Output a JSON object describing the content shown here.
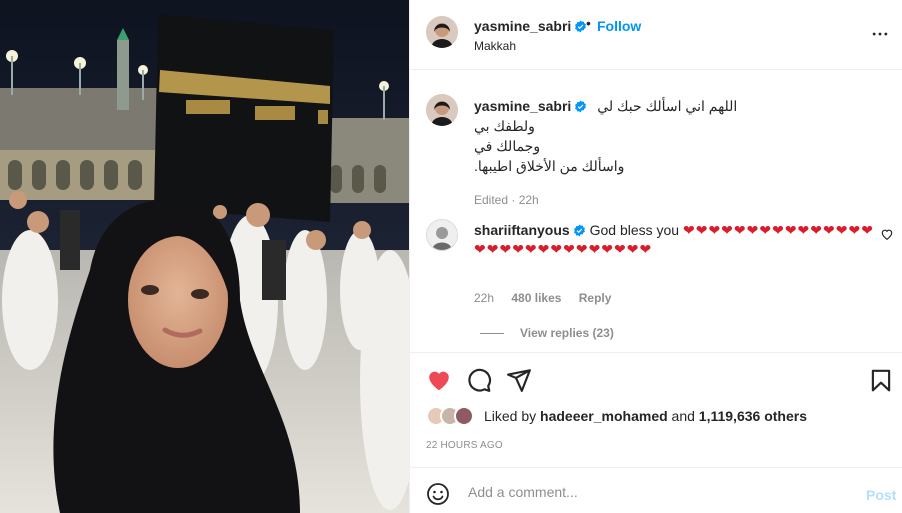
{
  "post": {
    "username": "yasmine_sabri",
    "location": "Makkah",
    "follow_label": "Follow",
    "dot": "•",
    "more_icon": "more-horizontal-icon",
    "caption_lines": [
      "اللهم اني اسألك حبك لي",
      "ولطفك بي",
      "وجمالك في",
      "واسألك من الأخلاق اطيبها."
    ],
    "edited": "Edited · 22h"
  },
  "comment": {
    "username": "shariiftanyous",
    "text": "God bless you",
    "hearts": "❤❤❤❤❤❤❤❤❤❤❤❤❤❤❤❤❤❤❤❤❤❤❤❤❤❤❤❤❤",
    "time": "22h",
    "likes": "480 likes",
    "reply": "Reply",
    "view_replies": "View replies (23)"
  },
  "actions": {
    "like_icon": "heart-filled-icon",
    "comment_icon": "comment-icon",
    "share_icon": "share-icon",
    "save_icon": "bookmark-icon",
    "liked_color": "#ed4956"
  },
  "likes": {
    "prefix": "Liked by",
    "user": "hadeeer_mohamed",
    "and": "and",
    "count": "1,119,636 others"
  },
  "timestamp": "22 HOURS AGO",
  "add_comment": {
    "placeholder": "Add a comment...",
    "post_label": "Post",
    "post_color": "#b2dffc"
  },
  "colors": {
    "verified": "#0095f6",
    "link": "#0095f6",
    "muted": "#8e8e8e"
  }
}
